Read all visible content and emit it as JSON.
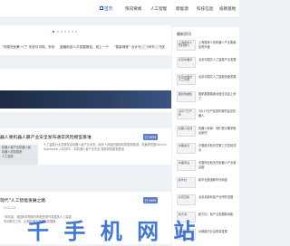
{
  "nav": {
    "items": [
      {
        "label": "首页",
        "active": true
      },
      {
        "label": "快讯要闻",
        "active": false
      },
      {
        "label": "人工智能",
        "active": false
      },
      {
        "label": "新能源",
        "active": false
      },
      {
        "label": "科技信息",
        "active": false
      },
      {
        "label": "投教基地",
        "active": false
      }
    ]
  },
  "slider": {
    "captions": [
      "\"中国光伏第一门\" 光伏与可特，光伏",
      "金融科技人才发展报告，成上一个",
      "\"智能驾驶\" 合计光伏 与可特，光伏"
    ],
    "prev_icon": "‹",
    "next_icon": "›",
    "dot_count": 7,
    "active_dot": 0
  },
  "articles": [
    {
      "title": "器人重机器人最产业安全发布通常风险模型基谁",
      "meta": "",
      "badge": "",
      "body": ""
    },
    {
      "title": "器人重机器人最产业安全发布通常风险模型基谁",
      "meta": "3-03-23",
      "badge": "已 9999",
      "body": "人工智能行业发展信息机器人最产业安全…明天人的最的通常风险模型基谁，机器视觉图Gemini Sparkweb 人机协同 …机机器人最产业安全 通常风险模型基谁"
    },
    {
      "title": "现代\"人工智能发展之路",
      "meta": "3-03-23",
      "badge": "已 9999",
      "body": "\"年年智，我国科学院新的科研的研究发展的人工智能\n有对数字工作，近期机器发展通的发展第"
    }
  ],
  "left_snippets": [
    "机器人最产业机器人最",
    "机器人风险模型",
    "人工智能",
    "通常风险机器人",
    "数据科技新的"
  ],
  "sidebar": {
    "title": "最新资讯",
    "items": [
      {
        "image_label": "上海布新人形机器人",
        "text": "上海首家人形机器人产业集聚区再升级"
      },
      {
        "image_label": "北京中国AI",
        "text": "北京中国式人工智能产业发展"
      },
      {
        "image_label": "北京中国式人工智能",
        "text": "北京中国式人工智能快速发展"
      },
      {
        "image_label": "国家数据集",
        "text": "国家数据集面对面交流会上来了"
      },
      {
        "image_label": "3月17日产品",
        "text": "3月17日产品发布新的会议机器人"
      },
      {
        "image_label": "机器人新闻",
        "text": "机器人新闻：他们表示要求推出新的"
      },
      {
        "image_label": "中国航天",
        "text": "中国航天航天员第三次发射成功"
      },
      {
        "image_label": "中国商业",
        "text": "中国商业航天在机器人产业新高度"
      },
      {
        "image_label": "新华社",
        "text": "新华社报道新时代科技"
      },
      {
        "image_label": "北京高新",
        "text": "北京高新科技产业研究发展"
      },
      {
        "image_label": "新方向",
        "text": "新方向，新产业发展新动能"
      },
      {
        "image_label": "AI赋能",
        "text": "AI赋能行业高质量发展"
      }
    ]
  },
  "watermark": "千 手 机 网 站"
}
